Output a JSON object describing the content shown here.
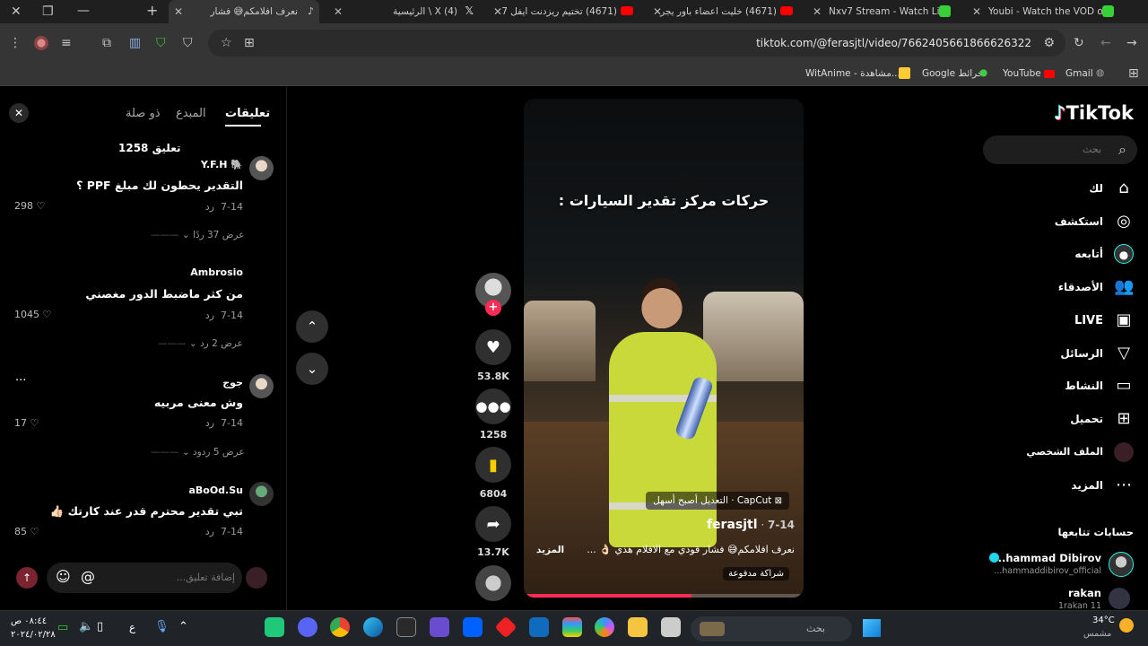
{
  "browser": {
    "tabs": [
      {
        "title": "Youbi - Watch the VOD on",
        "color": "#37d137"
      },
      {
        "title": "Nxv7 Stream - Watch Live",
        "color": "#37d137"
      },
      {
        "title": "(4671) خليت اعضاء باور يجر",
        "color": "#ff0000"
      },
      {
        "title": "(4671) تختيم ريزدنت ايفل 7",
        "color": "#ff0000"
      },
      {
        "title": "(4) X \\ الرئيسية",
        "color": "#ffffff"
      },
      {
        "title": "نعرف افلامكم😅 فشار",
        "color": "#ffffff"
      }
    ],
    "url": "tiktok.com/@ferasjtl/video/7662405661866626322",
    "bookmarks": [
      {
        "label": "Gmail"
      },
      {
        "label": "YouTube"
      },
      {
        "label": "Google خرائط"
      },
      {
        "label": "WitAnime - مشاهدة..."
      }
    ]
  },
  "comments_panel": {
    "tabs": [
      "تعليقات",
      "المبدع",
      "ذو صلة"
    ],
    "count_label": "1258 تعليق",
    "comments": [
      {
        "user": "Y.F.H 🐘",
        "text": "التقدير يحطون لك مبلغ PPF ؟",
        "date": "7-14",
        "reply": "رد",
        "likes": "298",
        "replies": "عرض 37 ردًا"
      },
      {
        "user": "Ambrosio",
        "text": "من كثر ماضبط الدور مغصني",
        "date": "7-14",
        "reply": "رد",
        "likes": "1045",
        "replies": "عرض 2 رد"
      },
      {
        "user": "جوج",
        "text": "وش معنى مربيه",
        "date": "7-14",
        "reply": "رد",
        "likes": "17",
        "replies": "عرض 5 ردود"
      },
      {
        "user": "aBoOd.Su",
        "text": "تبي تقدير محترم قدر عند كارتك 👍🏻",
        "date": "7-14",
        "reply": "رد",
        "likes": "85",
        "replies": ""
      }
    ],
    "input_placeholder": "إضافة تعليق...",
    "more": "..."
  },
  "video": {
    "overlay_title": "حركات مركز تقدير السيارات :",
    "author": "ferasjtl",
    "date": "7-14",
    "capcut_label": "CapCut · التعديل أصبح أسهل",
    "caption": "نعرف افلامكم😅 فشار قودي مع الافلام هذي 👌🏻 ...",
    "more_label": "المزيد",
    "paid_label": "شراكة مدفوعة",
    "progress": 0.6
  },
  "actions": {
    "likes": "53.8K",
    "comments": "1258",
    "saves": "6804",
    "shares": "13.7K"
  },
  "rightnav": {
    "logo": "TikTok",
    "search_placeholder": "بحث",
    "items": [
      "لك",
      "استكشف",
      "أتابعه",
      "الأصدقاء",
      "LIVE",
      "الرسائل",
      "النشاط",
      "تحميل",
      "الملف الشخصي",
      "المزيد"
    ],
    "following_title": "حسابات تتابعها",
    "following": [
      {
        "name": "...hammad Dibirov",
        "handle": "...hammaddibirov_official"
      },
      {
        "name": "rakan",
        "handle": "1rakan 11"
      }
    ]
  },
  "taskbar": {
    "search": "بحث",
    "weather": "34°C",
    "weather_label": "مشمس",
    "time": "٠٨:٤٤ ص",
    "date": "٢٠٢٤/٠٢/٢٨",
    "lang": "ع"
  }
}
